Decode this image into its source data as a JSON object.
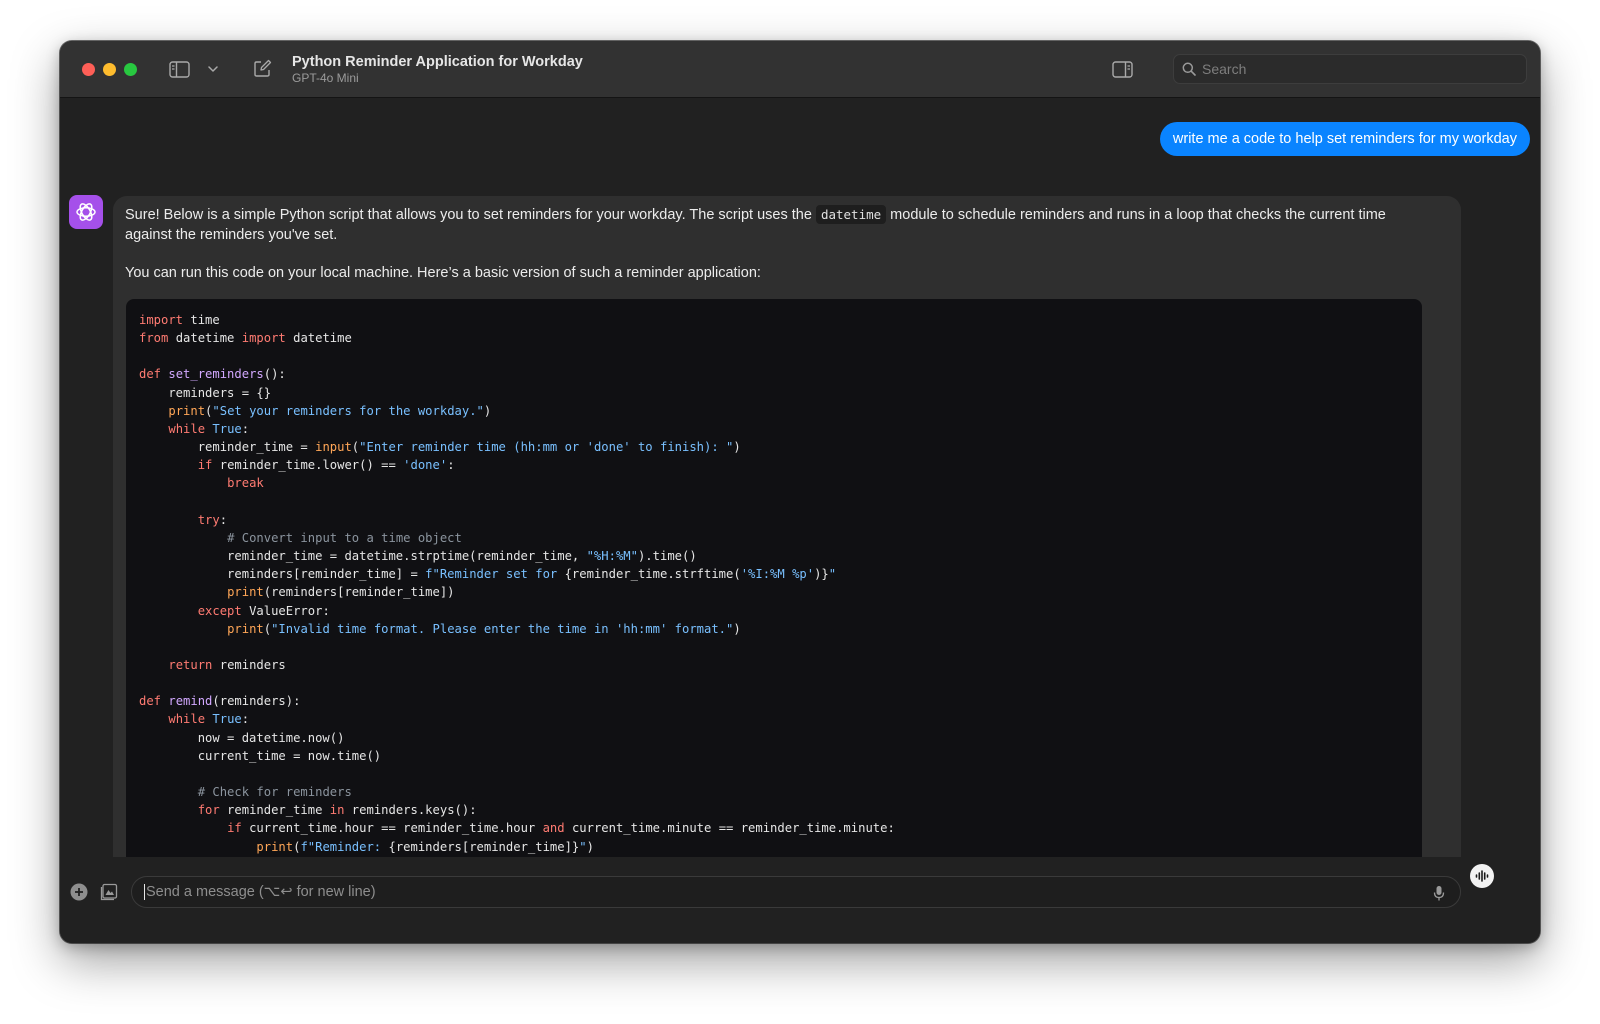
{
  "window": {
    "title": "Python Reminder Application for Workday",
    "subtitle": "GPT-4o Mini"
  },
  "toolbar": {
    "sidebar_toggle_icon": "sidebar-icon",
    "dropdown_icon": "chevron-down-icon",
    "new_chat_icon": "compose-icon",
    "panel_icon": "right-panel-icon"
  },
  "search": {
    "placeholder": "Search"
  },
  "user_message": {
    "text": "write me a code to help set reminders for my workday"
  },
  "assistant_message": {
    "para1_before": "Sure! Below is a simple Python script that allows you to set reminders for your workday. The script uses the ",
    "para1_code": "datetime",
    "para1_after": " module to schedule reminders and runs in a loop that checks the current time against the reminders you've set.",
    "para2": "You can run this code on your local machine. Here’s a basic version of such a reminder application:"
  },
  "code_language": "python",
  "code_lines": [
    "import time",
    "from datetime import datetime",
    "",
    "def set_reminders():",
    "    reminders = {}",
    "    print(\"Set your reminders for the workday.\")",
    "    while True:",
    "        reminder_time = input(\"Enter reminder time (hh:mm or 'done' to finish): \")",
    "        if reminder_time.lower() == 'done':",
    "            break",
    "",
    "        try:",
    "            # Convert input to a time object",
    "            reminder_time = datetime.strptime(reminder_time, \"%H:%M\").time()",
    "            reminders[reminder_time] = f\"Reminder set for {reminder_time.strftime('%I:%M %p')}\"",
    "            print(reminders[reminder_time])",
    "        except ValueError:",
    "            print(\"Invalid time format. Please enter the time in 'hh:mm' format.\")",
    "",
    "    return reminders",
    "",
    "def remind(reminders):",
    "    while True:",
    "        now = datetime.now()",
    "        current_time = now.time()",
    "",
    "        # Check for reminders",
    "        for reminder_time in reminders.keys():",
    "            if current_time.hour == reminder_time.hour and current_time.minute == reminder_time.minute:",
    "                print(f\"Reminder: {reminders[reminder_time]}\")"
  ],
  "composer": {
    "placeholder": "Send a message (⌥↩ for new line)",
    "add_icon": "plus-circle-icon",
    "library_icon": "image-library-icon",
    "mic_icon": "microphone-icon",
    "voice_icon": "voice-wave-icon"
  },
  "colors": {
    "window_bg": "#212121",
    "titlebar_bg": "#323232",
    "user_bubble": "#0a84ff",
    "assistant_bubble": "#2f2f2f",
    "code_bg": "#101013",
    "avatar_bg": "#a550ea",
    "keyword": "#ff7b72",
    "function": "#d2a8ff",
    "builtin": "#ffa657",
    "string": "#79c0ff",
    "comment": "#8b949e"
  }
}
